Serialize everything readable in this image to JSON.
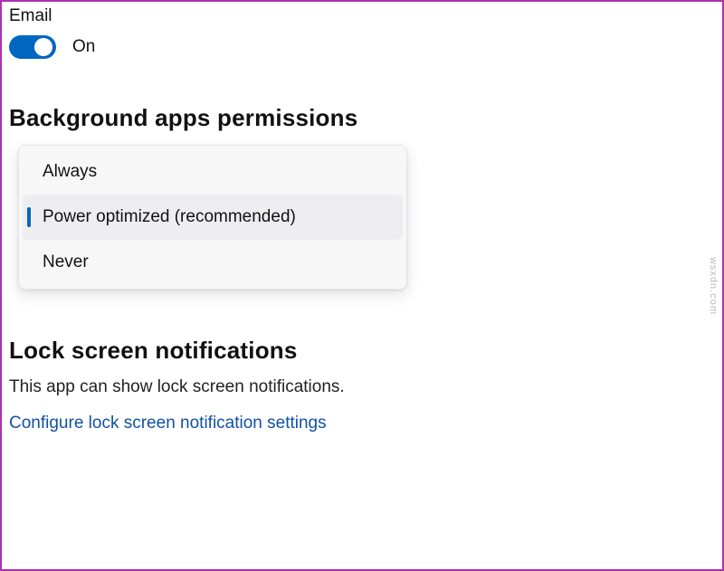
{
  "email": {
    "label": "Email",
    "toggle_state": "On"
  },
  "background": {
    "header": "Background apps permissions",
    "options": {
      "always": "Always",
      "power_optimized": "Power optimized (recommended)",
      "never": "Never"
    }
  },
  "lockscreen": {
    "header": "Lock screen notifications",
    "description": "This app can show lock screen notifications.",
    "link": "Configure lock screen notification settings"
  },
  "watermark": "wsxdn.com"
}
